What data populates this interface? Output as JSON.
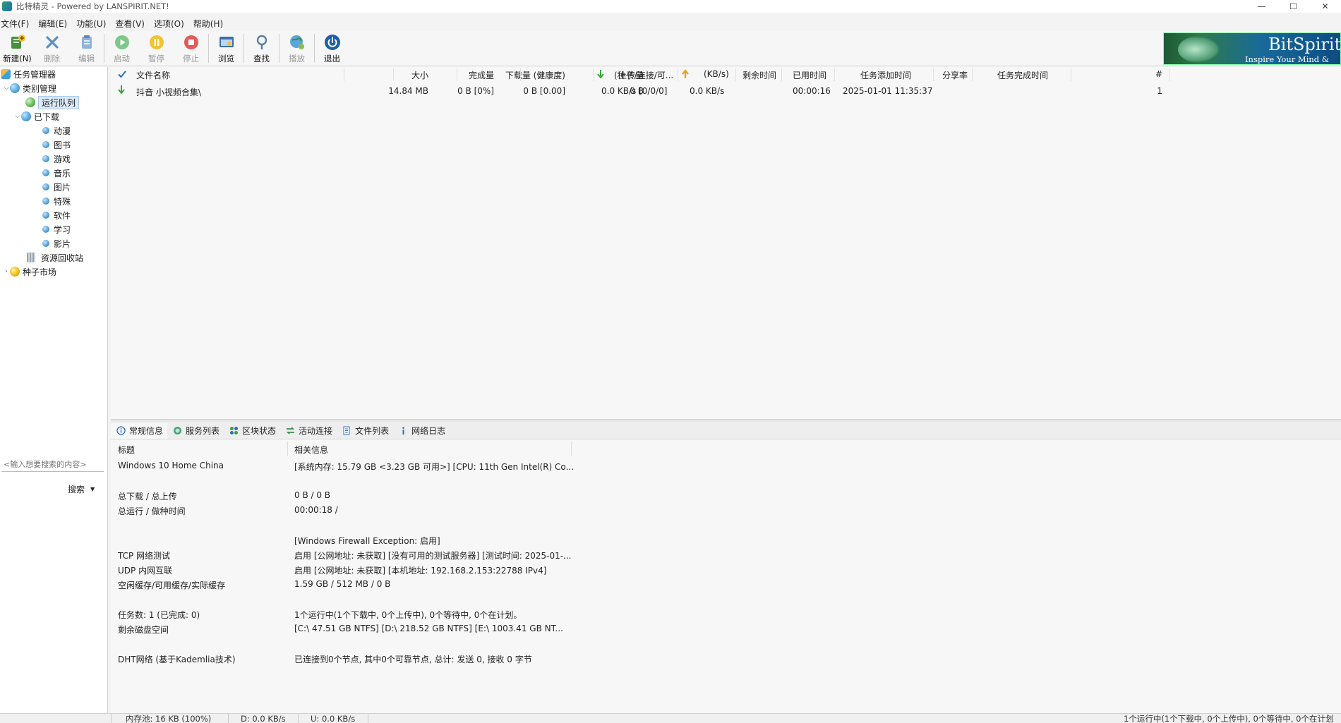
{
  "window": {
    "title": "比特精灵 - Powered by LANSPIRIT.NET!",
    "controls": {
      "minimize": "—",
      "maximize": "☐",
      "close": "✕"
    }
  },
  "menu": [
    "文件(F)",
    "编辑(E)",
    "功能(U)",
    "查看(V)",
    "选项(O)",
    "帮助(H)"
  ],
  "toolbar": {
    "new": "新建(N)",
    "delete": "删除",
    "edit": "编辑",
    "start": "启动",
    "pause": "暂停",
    "stop": "停止",
    "browse": "浏览",
    "find": "查找",
    "play": "播放",
    "exit": "退出"
  },
  "banner": {
    "name": "BitSpirit",
    "slogan": "Inspire Your Mind & Spirit"
  },
  "tree": {
    "root": "任务管理器",
    "category_mgmt": "类别管理",
    "running_queue": "运行队列",
    "downloaded": "已下载",
    "categories": [
      "动漫",
      "图书",
      "游戏",
      "音乐",
      "图片",
      "特殊",
      "软件",
      "学习",
      "影片"
    ],
    "recycle": "资源回收站",
    "seed_market": "种子市场"
  },
  "search": {
    "placeholder": "<输入想要搜索的内容>",
    "button": "搜索"
  },
  "task_columns": {
    "name": "文件名称",
    "size": "大小",
    "done": "完成量",
    "downloaded": "下载量 (健康度)",
    "uploaded": "上传量",
    "seeds": "(种子/连接/可...",
    "up_speed": "(KB/s)",
    "remaining": "剩余时间",
    "elapsed": "已用时间",
    "added": "任务添加时间",
    "share": "分享率",
    "completed": "任务完成时间",
    "index": "#"
  },
  "tasks": [
    {
      "name": "抖音 小视频合集\\",
      "size": "14.84 MB",
      "done": "0 B [0%]",
      "downloaded": "0 B [0.00]",
      "uploaded": "0 B",
      "down_speed": "0.0 KB/s [0/0/0]",
      "up_speed": "0.0 KB/s",
      "remaining": "",
      "elapsed": "00:00:16",
      "added": "2025-01-01 11:35:37",
      "share": "",
      "completed": "",
      "index": "1"
    }
  ],
  "bottom_tabs": [
    "常规信息",
    "服务列表",
    "区块状态",
    "活动连接",
    "文件列表",
    "网络日志"
  ],
  "info": {
    "head_title": "标题",
    "head_info": "相关信息",
    "rows": [
      {
        "label": "Windows 10 Home China",
        "value": "[系统内存: 15.79 GB <3.23 GB 可用>] [CPU: 11th Gen Intel(R) Co..."
      },
      {
        "label": "总下载 / 总上传",
        "value": "0 B / 0 B"
      },
      {
        "label": "总运行 / 做种时间",
        "value": "00:00:18 /"
      },
      {
        "label": "",
        "value": "[Windows Firewall Exception: 启用]"
      },
      {
        "label": "TCP 网络测试",
        "value": "启用 [公网地址: 未获取] [没有可用的测试服务器] [测试时间: 2025-01-..."
      },
      {
        "label": "UDP 内网互联",
        "value": "启用 [公网地址: 未获取] [本机地址: 192.168.2.153:22788 IPv4]"
      },
      {
        "label": "空闲缓存/可用缓存/实际缓存",
        "value": "1.59 GB / 512 MB / 0 B"
      },
      {
        "label": "任务数: 1 (已完成: 0)",
        "value": "1个运行中(1个下载中, 0个上传中), 0个等待中, 0个在计划。"
      },
      {
        "label": "剩余磁盘空间",
        "value": "[C:\\ 47.51 GB  NTFS]  [D:\\ 218.52 GB  NTFS]  [E:\\ 1003.41 GB  NT..."
      },
      {
        "label": "DHT网络 (基于Kademlia技术)",
        "value": "已连接到0个节点, 其中0个可靠节点, 总计: 发送 0, 接收 0 字节"
      }
    ]
  },
  "status": {
    "memory": "内存池: 16 KB (100%)",
    "down": "D: 0.0 KB/s",
    "up": "U: 0.0 KB/s",
    "summary": "1个运行中(1个下载中, 0个上传中), 0个等待中, 0个在计划"
  },
  "colors": {
    "accent": "#1f6fb8",
    "tree_selected": "#dbe9f8",
    "down_arrow": "#3aa33a",
    "up_arrow": "#f0a020"
  }
}
